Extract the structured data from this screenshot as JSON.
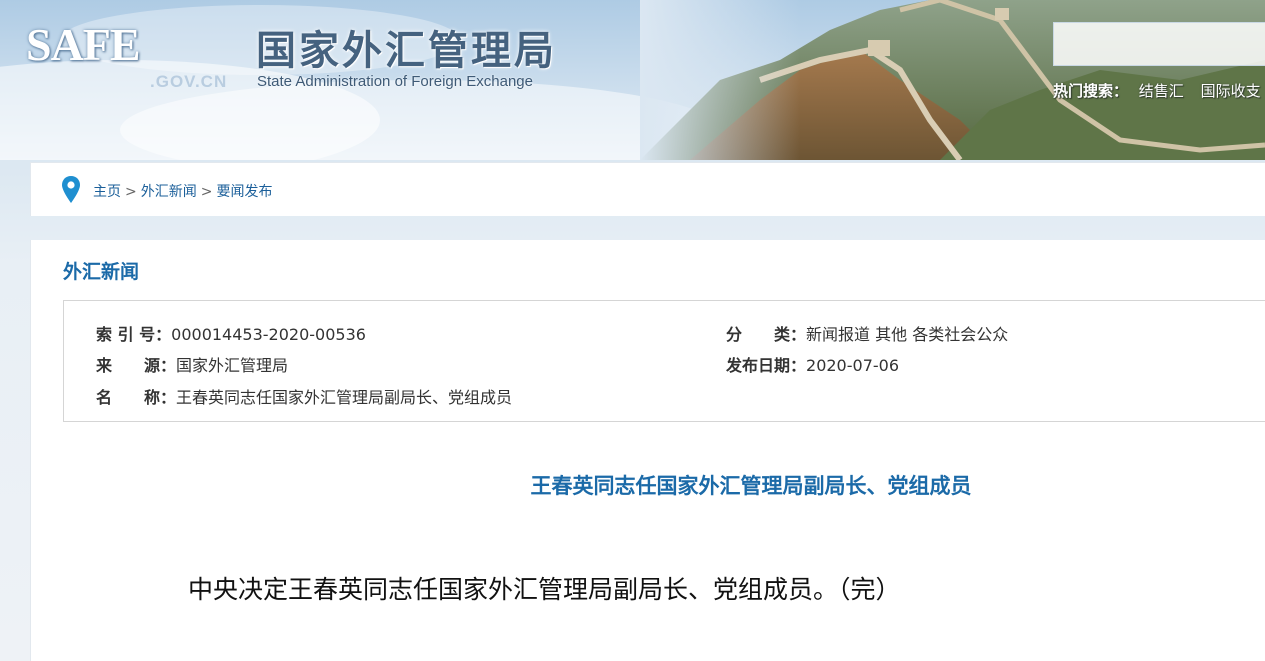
{
  "header": {
    "logo_text": "SAFE",
    "logo_domain": ".GOV.CN",
    "site_name_cn": "国家外汇管理局",
    "site_name_en": "State Administration of Foreign Exchange",
    "search": {
      "placeholder": ""
    },
    "hot_search": {
      "label": "热门搜索：",
      "items": [
        "结售汇",
        "国际收支"
      ]
    }
  },
  "breadcrumb": {
    "items": [
      "主页",
      "外汇新闻",
      "要闻发布"
    ],
    "separator": ">"
  },
  "section": {
    "title": "外汇新闻"
  },
  "meta": {
    "index_label": "索 引 号：",
    "index_value": "000014453-2020-00536",
    "category_label": "分　　类：",
    "category_value": "新闻报道  其他  各类社会公众",
    "source_label": "来　　源：",
    "source_value": "国家外汇管理局",
    "date_label": "发布日期：",
    "date_value": "2020-07-06",
    "name_label": "名　　称：",
    "name_value": "王春英同志任国家外汇管理局副局长、党组成员"
  },
  "article": {
    "title": "王春英同志任国家外汇管理局副局长、党组成员",
    "body": "中央决定王春英同志任国家外汇管理局副局长、党组成员。（完）"
  },
  "colors": {
    "accent": "#1b6aa8",
    "link": "#1b5f9a"
  }
}
